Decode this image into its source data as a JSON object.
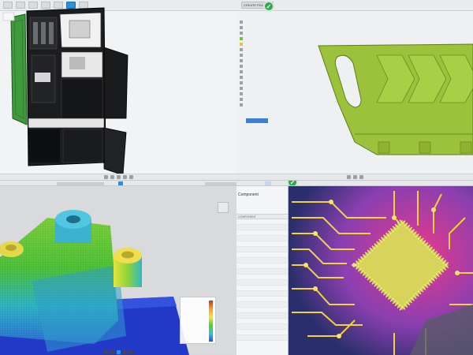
{
  "top_left": {
    "toolbar": {
      "buttons": [
        "",
        "",
        "",
        "",
        "",
        "",
        ""
      ]
    }
  },
  "top_right": {
    "toolbar": {
      "title": "CREATE FEATURE"
    },
    "browser": {
      "rows": [
        "",
        "",
        "",
        "",
        "",
        "",
        "",
        "",
        "",
        "",
        "",
        "",
        "",
        "",
        "",
        ""
      ],
      "apply_label": ""
    }
  },
  "bottom_left": {
    "legend": {
      "title": "",
      "ticks": [
        "",
        "",
        "",
        "",
        "",
        ""
      ]
    }
  },
  "bottom_right": {
    "table": {
      "header_lines": [
        "",
        "Component",
        "",
        ""
      ],
      "columns": [
        "COMPONENT",
        "",
        ""
      ],
      "rows": [
        "",
        "",
        "",
        "",
        "",
        "",
        "",
        "",
        "",
        "",
        "",
        "",
        "",
        "",
        "",
        "",
        "",
        "",
        "",
        "",
        "",
        ""
      ]
    }
  },
  "colors": {
    "accent": "#2d8fd6",
    "success": "#2fa84f",
    "part_green": "#9bc23a",
    "cabinet_green": "#3f9a3c",
    "pcb_blue": "#2a2f6b",
    "pcb_trace": "#f0d43a",
    "pcb_chip": "#d8d35a"
  },
  "icons": [
    "check-icon",
    "home-icon",
    "chevron-down-icon"
  ]
}
